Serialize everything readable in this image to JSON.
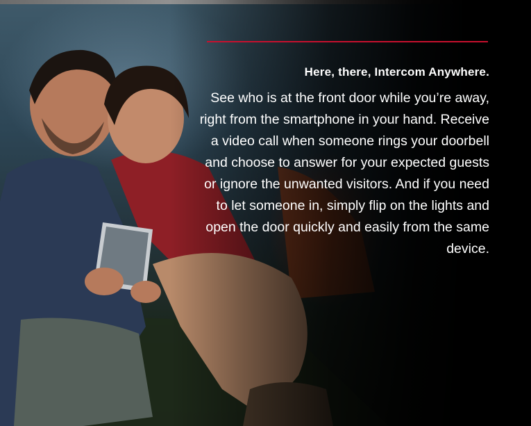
{
  "colors": {
    "accent": "#c8102e",
    "text": "#ffffff",
    "background": "#000000"
  },
  "feature": {
    "headline": "Here, there, Intercom Anywhere.",
    "body": "See who is at the front door while you’re away, right from the smartphone in your hand. Receive a video call when someone rings your doorbell and choose to answer for your expected guests or ignore the unwanted visitors. And if you need to let someone in, simply flip on the lights and open the door quickly and easily from the same device."
  },
  "photo": {
    "subject": "couple-looking-at-tablet-outdoors"
  }
}
